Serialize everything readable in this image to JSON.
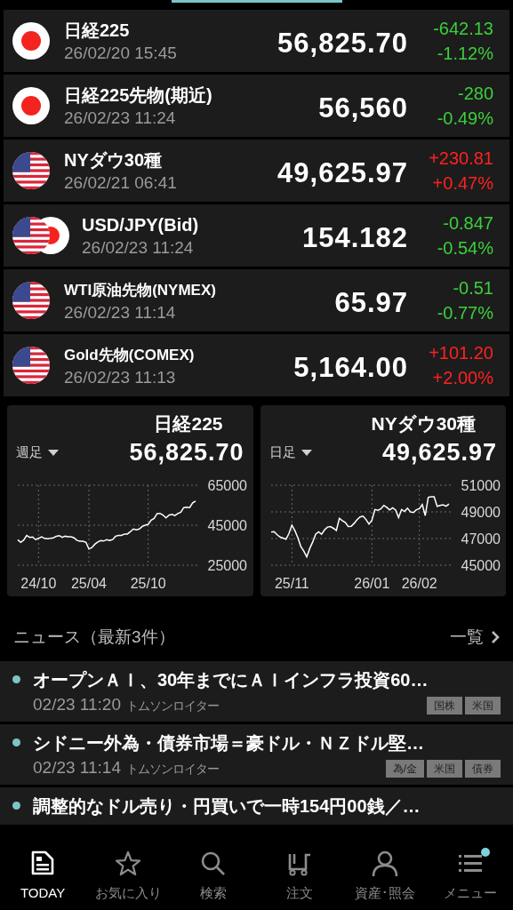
{
  "quotes": [
    {
      "kind": "jp",
      "name": "日経225",
      "time": "26/02/20 15:45",
      "price": "56,825.70",
      "change": "-642.13",
      "percent": "-1.12%",
      "color": "#3ccf3c"
    },
    {
      "kind": "jp",
      "name": "日経225先物(期近)",
      "time": "26/02/23 11:24",
      "price": "56,560",
      "change": "-280",
      "percent": "-0.49%",
      "color": "#3ccf3c"
    },
    {
      "kind": "us",
      "name": "NYダウ30種",
      "time": "26/02/21 06:41",
      "price": "49,625.97",
      "change": "+230.81",
      "percent": "+0.47%",
      "color": "#ff2121"
    },
    {
      "kind": "us-jp",
      "name": "USD/JPY(Bid)",
      "time": "26/02/23 11:24",
      "price": "154.182",
      "change": "-0.847",
      "percent": "-0.54%",
      "color": "#3ccf3c"
    },
    {
      "kind": "us",
      "name": "WTI原油先物(NYMEX)",
      "time": "26/02/23 11:14",
      "price": "65.97",
      "change": "-0.51",
      "percent": "-0.77%",
      "color": "#3ccf3c"
    },
    {
      "kind": "us",
      "name": "Gold先物(COMEX)",
      "time": "26/02/23 11:13",
      "price": "5,164.00",
      "change": "+101.20",
      "percent": "+2.00%",
      "color": "#ff2121"
    }
  ],
  "chart_cards": [
    {
      "title": "日経225",
      "period": "週足",
      "price": "56,825.70",
      "chart_data": {
        "type": "line",
        "grid": true,
        "categories": [
          null,
          null,
          null,
          null,
          null,
          null,
          null,
          "24/10",
          null,
          null,
          null,
          null,
          null,
          null,
          null,
          null,
          null,
          null,
          null,
          null,
          null,
          null,
          null,
          null,
          "25/04",
          null,
          null,
          null,
          null,
          null,
          null,
          null,
          null,
          null,
          null,
          null,
          null,
          null,
          null,
          null,
          null,
          null,
          null,
          null,
          "25/10",
          null,
          null,
          null,
          null,
          null,
          null,
          null,
          null,
          null,
          null,
          null,
          null,
          null,
          null,
          null,
          null
        ],
        "series": [
          {
            "values": [
              37700,
              36400,
              37600,
              39900,
              38900,
              39100,
              37800,
              38400,
              39200,
              38400,
              38200,
              38400,
              38700,
              39500,
              39800,
              38900,
              39500,
              39200,
              39200,
              38700,
              37400,
              37000,
              37000,
              36400,
              33100,
              33800,
              35500,
              36600,
              37300,
              37100,
              37800,
              37400,
              37800,
              39500,
              39900,
              39900,
              40600,
              40600,
              41800,
              43100,
              42700,
              43100,
              44400,
              45000,
              45400,
              47500,
              48400,
              50800,
              50900,
              50100,
              48700,
              50000,
              50400,
              49800,
              50800,
              51500,
              53800,
              54000,
              53800,
              56200,
              57100
            ]
          }
        ],
        "yticks": [
          25000,
          45000,
          65000
        ],
        "ylim": [
          25000,
          65000
        ]
      }
    },
    {
      "title": "NYダウ30種",
      "period": "日足",
      "price": "49,625.97",
      "chart_data": {
        "type": "line",
        "grid": true,
        "categories": [
          null,
          null,
          null,
          null,
          null,
          null,
          null,
          "25/11",
          null,
          null,
          null,
          null,
          null,
          null,
          null,
          null,
          null,
          null,
          null,
          null,
          null,
          null,
          null,
          null,
          null,
          null,
          null,
          null,
          null,
          null,
          null,
          null,
          null,
          null,
          "26/01",
          null,
          null,
          null,
          null,
          null,
          null,
          null,
          null,
          null,
          null,
          null,
          null,
          null,
          null,
          null,
          "26/02",
          null,
          null,
          null,
          null,
          null,
          null,
          null,
          null,
          null,
          null
        ],
        "series": [
          {
            "values": [
              47480,
              47520,
              47280,
              47110,
              47030,
              46950,
              47380,
              48000,
              47590,
              47070,
              46410,
              46060,
              45620,
              46240,
              46740,
              47320,
              47500,
              47320,
              47650,
              47860,
              47900,
              47770,
              47610,
              48520,
              48350,
              48210,
              47900,
              47920,
              48140,
              48410,
              48620,
              48680,
              48430,
              48080,
              48370,
              49180,
              49120,
              49220,
              49490,
              49340,
              49140,
              49300,
              49140,
              48580,
              49180,
              49030,
              49280,
              48990,
              48950,
              49160,
              49240,
              49550,
              48720,
              50090,
              50130,
              50130,
              49410,
              49490,
              49530,
              49430,
              49590
            ]
          }
        ],
        "yticks": [
          45000,
          47000,
          49000,
          51000
        ],
        "ylim": [
          45000,
          51000
        ]
      }
    }
  ],
  "news_header": {
    "title": "ニュース（最新3件）",
    "link": "一覧"
  },
  "news": [
    {
      "title": "オープンＡＩ、30年までにＡＩインフラ投資60…",
      "time": "02/23 11:20",
      "source": "トムソンロイター",
      "tags": [
        "国株",
        "米国"
      ]
    },
    {
      "title": "シドニー外為・債券市場＝豪ドル・ＮＺドル堅…",
      "time": "02/23 11:14",
      "source": "トムソンロイター",
      "tags": [
        "為/金",
        "米国",
        "債券"
      ]
    },
    {
      "title": "調整的なドル売り・円買いで一時154円00銭／…"
    }
  ],
  "nav": [
    {
      "label": "TODAY",
      "selected": true
    },
    {
      "label": "お気に入り",
      "selected": false
    },
    {
      "label": "検索",
      "selected": false
    },
    {
      "label": "注文",
      "selected": false
    },
    {
      "label": "資産･照会",
      "selected": false
    },
    {
      "label": "メニュー",
      "selected": false,
      "badge": true
    }
  ]
}
